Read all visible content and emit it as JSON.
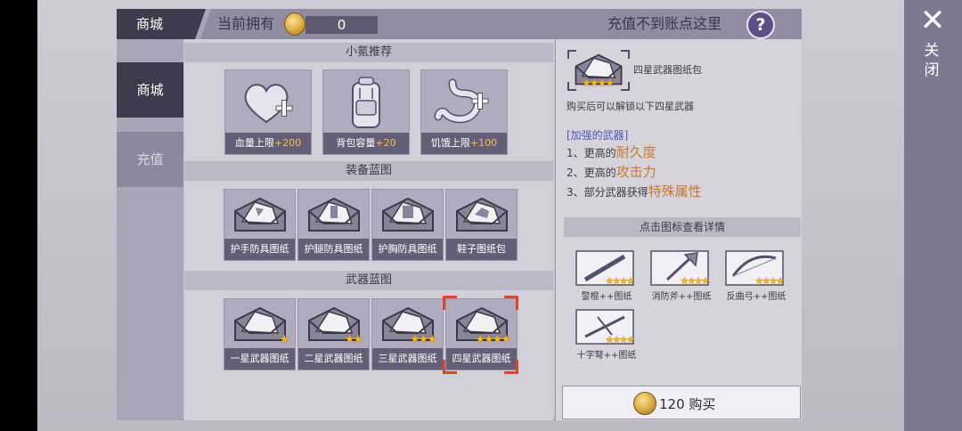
{
  "close": {
    "icon": "close-icon",
    "label": "关闭"
  },
  "header": {
    "title": "商城",
    "own_label": "当前拥有",
    "own_value": "0",
    "recharge_link": "充值不到账点这里",
    "help": "?"
  },
  "sidebar": {
    "items": [
      {
        "label": "商城",
        "active": true
      },
      {
        "label": "充值",
        "active": false
      }
    ]
  },
  "sections": {
    "recommend": "小氪推荐",
    "equipment": "装备蓝图",
    "weapons": "武器蓝图"
  },
  "recommend_items": [
    {
      "label": "血量上限",
      "plus": "+200"
    },
    {
      "label": "背包容量",
      "plus": "+20"
    },
    {
      "label": "饥饿上限",
      "plus": "+100"
    }
  ],
  "equipment_items": [
    {
      "label": "护手防具图纸"
    },
    {
      "label": "护腿防具图纸"
    },
    {
      "label": "护胸防具图纸"
    },
    {
      "label": "鞋子图纸包"
    }
  ],
  "weapon_items": [
    {
      "label": "一星武器图纸",
      "stars": "★"
    },
    {
      "label": "二星武器图纸",
      "stars": "★★"
    },
    {
      "label": "三星武器图纸",
      "stars": "★★★"
    },
    {
      "label": "四星武器图纸",
      "stars": "★★★★",
      "selected": true
    }
  ],
  "detail": {
    "name": "四星武器图纸包",
    "stars": "★★★★",
    "desc": "购买后可以解锁以下四星武器",
    "bonus_title": "[加强的武器]",
    "bonuses": [
      {
        "prefix": "1、更高的",
        "highlight": "耐久度"
      },
      {
        "prefix": "2、更高的",
        "highlight": "攻击力"
      },
      {
        "prefix": "3、部分武器获得",
        "highlight": "特殊属性"
      }
    ],
    "list_header": "点击图标查看详情",
    "weapons": [
      {
        "label": "警棍++图纸",
        "stars": "★★★★"
      },
      {
        "label": "消防斧++图纸",
        "stars": "★★★★"
      },
      {
        "label": "反曲弓++图纸",
        "stars": "★★★★"
      },
      {
        "label": "十字弩++图纸",
        "stars": "★★★★"
      }
    ],
    "buy_label": "120 购买"
  },
  "colors": {
    "accent_dark": "#3f3b4d",
    "label_bg": "#645e76",
    "highlight": "#c77a2b",
    "selection": "#e0452a",
    "star": "#f3b722"
  }
}
